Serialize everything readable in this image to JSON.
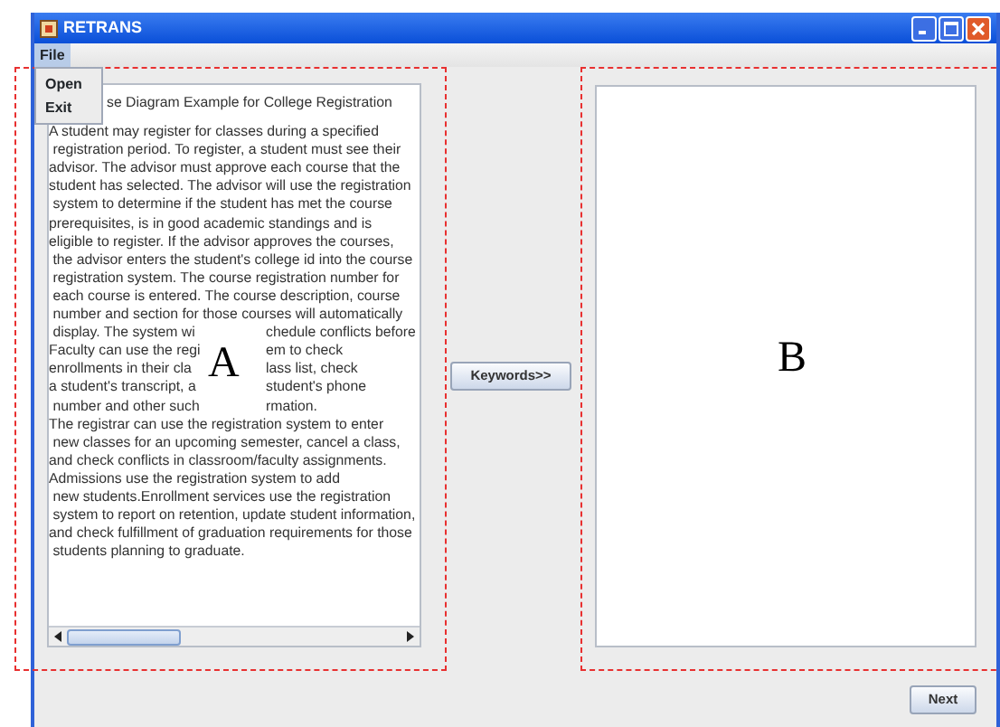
{
  "window": {
    "title": "RETRANS"
  },
  "menu_bar": [
    {
      "label": "File",
      "selected": true
    }
  ],
  "menu_popup": {
    "items": [
      "Open",
      "Exit"
    ]
  },
  "left_text_area": {
    "heading": "se Diagram Example for College Registration",
    "lines": [
      {
        "segments": [
          "A student may register for classes during a specified"
        ]
      },
      {
        "segments": [
          " registration period. To register, a student must see their"
        ]
      },
      {
        "segments": [
          "advisor. The advisor must approve each course that the"
        ]
      },
      {
        "segments": [
          "student has selected. The advisor will use the registration"
        ]
      },
      {
        "segments": [
          " system to determine if the student has met the course"
        ]
      },
      {
        "segments": [
          "prerequisites, is in good academic standings and is"
        ]
      },
      {
        "segments": [
          "eligible to register. If the advisor approves the courses,"
        ]
      },
      {
        "segments": [
          " the advisor enters the student's college id into the course"
        ]
      },
      {
        "segments": [
          " registration system. The course registration number for"
        ]
      },
      {
        "segments": [
          " each course is entered. The course description, course"
        ]
      },
      {
        "segments": [
          " number and section for those courses will automatically"
        ]
      },
      {
        "segments": [
          " display. The system wi",
          "chedule conflicts before"
        ]
      },
      {
        "segments": [
          "Faculty can use the regi",
          "em to check"
        ]
      },
      {
        "segments": [
          "enrollments in their cla",
          "lass list, check"
        ]
      },
      {
        "segments": [
          "a student's transcript, a",
          "student's phone"
        ]
      },
      {
        "segments": [
          " number and other such",
          "rmation."
        ]
      },
      {
        "segments": [
          "The registrar can use the registration system to enter"
        ]
      },
      {
        "segments": [
          " new classes for an upcoming semester, cancel a class,"
        ]
      },
      {
        "segments": [
          "and check conflicts in classroom/faculty assignments."
        ]
      },
      {
        "segments": [
          "Admissions use the registration system to add"
        ]
      },
      {
        "segments": [
          " new students.Enrollment services use the registration"
        ]
      },
      {
        "segments": [
          " system to report on retention, update student information,"
        ]
      },
      {
        "segments": [
          "and check fulfillment of graduation requirements for those"
        ]
      },
      {
        "segments": [
          " students planning to graduate."
        ]
      }
    ]
  },
  "keywords_button": "Keywords>>",
  "annotations": [
    {
      "label": "A"
    },
    {
      "label": "B"
    }
  ],
  "next_button": "Next"
}
